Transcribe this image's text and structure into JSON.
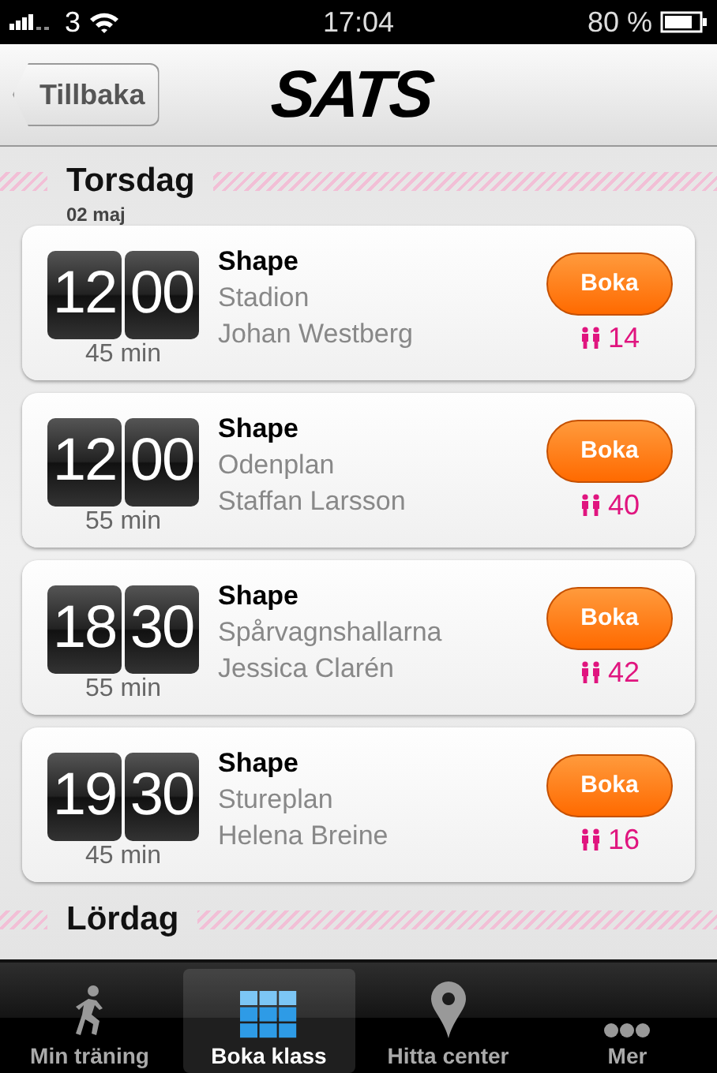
{
  "status_bar": {
    "carrier": "3",
    "time": "17:04",
    "battery": "80 %"
  },
  "nav": {
    "back": "Tillbaka",
    "logo": "SATS"
  },
  "days": [
    {
      "day": "Torsdag",
      "date": "02 maj",
      "classes": [
        {
          "hour": "12",
          "minute": "00",
          "duration": "45 min",
          "name": "Shape",
          "place": "Stadion",
          "instructor": "Johan Westberg",
          "button": "Boka",
          "spots": "14"
        },
        {
          "hour": "12",
          "minute": "00",
          "duration": "55 min",
          "name": "Shape",
          "place": "Odenplan",
          "instructor": "Staffan Larsson",
          "button": "Boka",
          "spots": "40"
        },
        {
          "hour": "18",
          "minute": "30",
          "duration": "55 min",
          "name": "Shape",
          "place": "Spårvagnshallarna",
          "instructor": "Jessica Clarén",
          "button": "Boka",
          "spots": "42"
        },
        {
          "hour": "19",
          "minute": "30",
          "duration": "45 min",
          "name": "Shape",
          "place": "Stureplan",
          "instructor": "Helena Breine",
          "button": "Boka",
          "spots": "16"
        }
      ]
    },
    {
      "day": "Lördag"
    }
  ],
  "tabs": [
    {
      "label": "Min träning",
      "kind": "runner",
      "selected": false
    },
    {
      "label": "Boka klass",
      "kind": "grid",
      "selected": true
    },
    {
      "label": "Hitta center",
      "kind": "pin",
      "selected": false
    },
    {
      "label": "Mer",
      "kind": "dots",
      "selected": false
    }
  ]
}
